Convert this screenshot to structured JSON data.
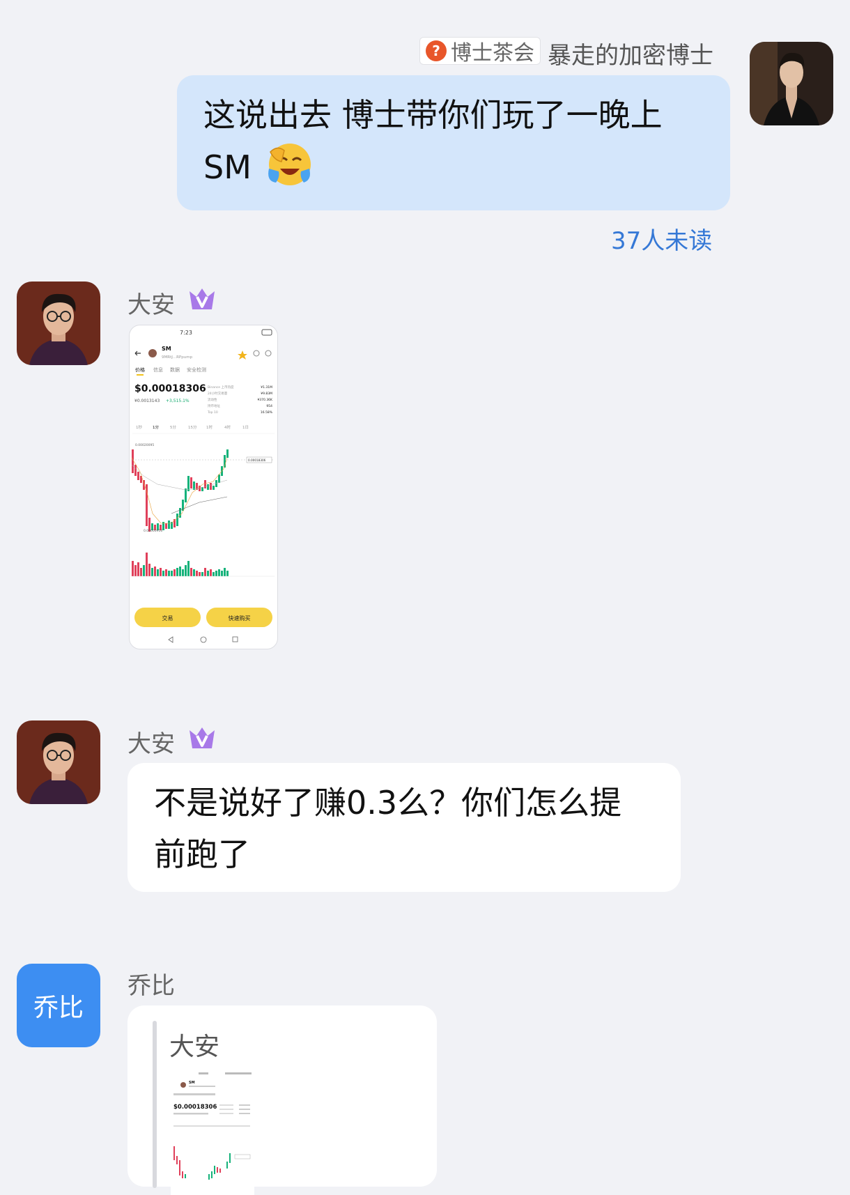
{
  "chat": {
    "outgoing": {
      "group_tag_icon": "question-mark-icon",
      "group_tag": "博士茶会",
      "sender": "暴走的加密博士",
      "text_line1": "这说出去 博士带你们玩了一晚上",
      "text_line2": "SM",
      "emoji": "laughing-crying-emoji",
      "unread": "37人未读"
    },
    "message1": {
      "sender": "大安",
      "badge_icon": "vip-crown-icon",
      "image": {
        "status_time": "7:23",
        "token_symbol": "SM",
        "token_address": "9MRtJ...RPpump",
        "tabs": [
          "价格",
          "信息",
          "数据",
          "安全检测"
        ],
        "price": "$0.00018306",
        "price_cny": "¥0.0013143",
        "change": "+3,515.1%",
        "stats_labels": [
          "Binance 上币热度",
          "24小时交易量",
          "流动性",
          "持币地址",
          "Top 10"
        ],
        "stats_values": [
          "¥1.31M",
          "¥9.83M",
          "¥370.36K",
          "954",
          "16.58%"
        ],
        "intervals": [
          "1秒",
          "1分",
          "5分",
          "15分",
          "1时",
          "4时",
          "1日"
        ],
        "high_label": "0.00020095",
        "low_label": "0.00000916",
        "last_price_tag": "0.00018306",
        "buy_button": "交易",
        "quick_buy_button": "快速购买"
      }
    },
    "message2": {
      "sender": "大安",
      "badge_icon": "vip-crown-icon",
      "text_line1": "不是说好了赚0.3么？你们怎么提",
      "text_line2": "前跑了"
    },
    "message3": {
      "sender": "乔比",
      "avatar_text": "乔比",
      "quote_sender": "大安",
      "quote_image": {
        "token_symbol": "SM",
        "price": "$0.00018306"
      }
    }
  }
}
